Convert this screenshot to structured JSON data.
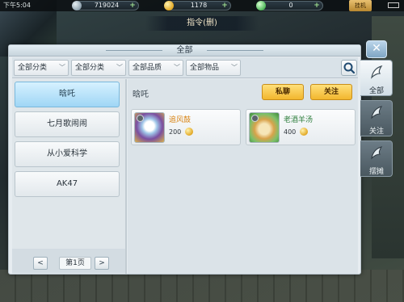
{
  "status_bar": {
    "time": "下午5:04",
    "currency_1": "719024",
    "currency_2": "1178",
    "currency_3": "0",
    "mode_label": "挂机"
  },
  "quest_banner": "指令(删)",
  "panel": {
    "title": "全部",
    "close_label": "✕"
  },
  "filters": [
    {
      "label": "全部分类"
    },
    {
      "label": "全部分类"
    },
    {
      "label": "全部品质"
    },
    {
      "label": "全部物品"
    }
  ],
  "left_list": {
    "items": [
      {
        "label": "晗吒",
        "active": true
      },
      {
        "label": "七月歌闹闹",
        "active": false
      },
      {
        "label": "从小爱科学",
        "active": false
      },
      {
        "label": "AK47",
        "active": false
      }
    ],
    "pager": {
      "prev": "<",
      "page_label": "第1页",
      "next": ">"
    }
  },
  "content": {
    "seller_name": "晗吒",
    "buttons": {
      "private_chat": "私聊",
      "follow": "关注"
    },
    "items": [
      {
        "name": "追风鼓",
        "price": "200",
        "name_color": "#d88415"
      },
      {
        "name": "老酒羊汤",
        "price": "400",
        "name_color": "#2f7f3e"
      }
    ]
  },
  "side_tabs": [
    {
      "label": "全部",
      "active": true
    },
    {
      "label": "关注",
      "active": false
    },
    {
      "label": "摆摊",
      "active": false
    }
  ],
  "colors": {
    "accent_gold": "#f2b62e",
    "active_blue": "#9fd6f5"
  }
}
